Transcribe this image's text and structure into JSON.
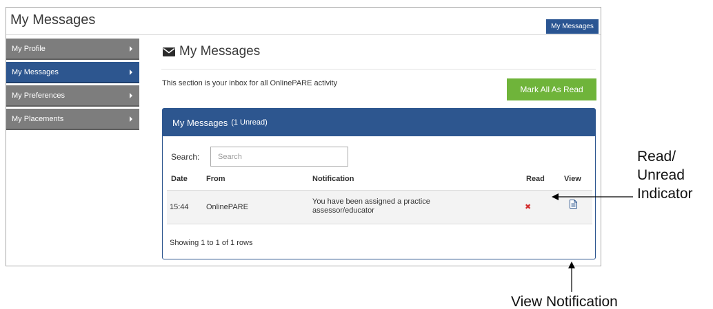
{
  "window": {
    "title": "My Messages",
    "header_pill": "My Messages"
  },
  "sidebar": {
    "items": [
      {
        "label": "My Profile",
        "active": false
      },
      {
        "label": "My Messages",
        "active": true
      },
      {
        "label": "My Preferences",
        "active": false
      },
      {
        "label": "My Placements",
        "active": false
      }
    ]
  },
  "main": {
    "heading": "My Messages",
    "intro": "This section is your inbox for all OnlinePARE activity",
    "mark_all_label": "Mark All As Read"
  },
  "panel": {
    "title": "My Messages",
    "unread_text": "(1 Unread)",
    "search_label": "Search:",
    "search_placeholder": "Search",
    "columns": [
      "Date",
      "From",
      "Notification",
      "Read",
      "View"
    ],
    "rows": [
      {
        "date": "15:44",
        "from": "OnlinePARE",
        "notification": "You have been assigned a practice assessor/educator",
        "read": false
      }
    ],
    "footer": "Showing 1 to 1 of 1 rows"
  },
  "annotations": {
    "read_indicator": [
      "Read/",
      "Unread",
      "Indicator"
    ],
    "view_notification": "View Notification"
  },
  "colors": {
    "brand_blue": "#2d568f",
    "sidebar_gray": "#7d7d7d",
    "accent_green": "#6fb43a",
    "unread_red": "#d32f2f"
  },
  "icons": {
    "heading": "envelope-icon",
    "unread": "x-icon",
    "view": "document-icon"
  }
}
